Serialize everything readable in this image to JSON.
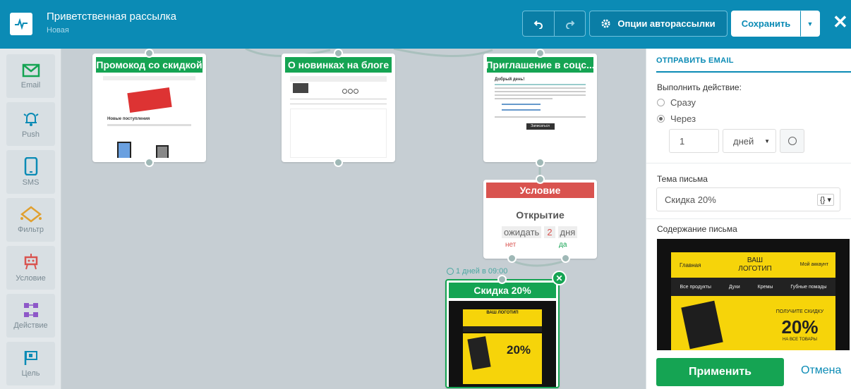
{
  "header": {
    "title": "Приветственная рассылка",
    "subtitle": "Новая",
    "options_label": "Опции авторассылки",
    "save_label": "Сохранить",
    "undo_icon": "undo-icon",
    "redo_icon": "redo-icon"
  },
  "toolbar": {
    "items": [
      {
        "label": "Email",
        "icon": "envelope-icon"
      },
      {
        "label": "Push",
        "icon": "bell-icon"
      },
      {
        "label": "SMS",
        "icon": "phone-icon"
      },
      {
        "label": "Фильтр",
        "icon": "filter-icon"
      },
      {
        "label": "Условие",
        "icon": "condition-icon"
      },
      {
        "label": "Действие",
        "icon": "action-icon"
      },
      {
        "label": "Цель",
        "icon": "flag-icon"
      }
    ]
  },
  "canvas": {
    "node1": {
      "title": "Промокод со скидкой",
      "pv_title": "Новые поступления"
    },
    "node2": {
      "title": "О новинках на блоге"
    },
    "node3": {
      "title": "Приглашение в соцс...",
      "pv_title": "Добрый день!",
      "pv_button": "Записаться"
    },
    "condition": {
      "title": "Условие",
      "event": "Открытие",
      "wait_label": "ожидать",
      "wait_value": "2",
      "wait_unit": "дня",
      "no_label": "нет",
      "yes_label": "да"
    },
    "timer": {
      "text": "1 дней в 09:00"
    },
    "node4": {
      "title": "Скидка 20%",
      "pv_logo": "ВАШ ЛОГОТИП",
      "pv_percent": "20%"
    }
  },
  "panel": {
    "heading": "ОТПРАВИТЬ EMAIL",
    "action_label": "Выполнить действие:",
    "option_now": "Сразу",
    "option_delay": "Через",
    "delay_value": "1",
    "delay_unit": "дней",
    "subject_label": "Тема письма",
    "subject_value": "Скидка 20%",
    "content_label": "Содержание письма",
    "preview": {
      "logo": "ВАШ ЛОГОТИП",
      "nav_left": "Главная",
      "nav_right": "Мой аккаунт",
      "menu": [
        "Все продукты",
        "Духи",
        "Кремы",
        "Губные помады"
      ],
      "promo_line1": "ПОЛУЧИТЕ СКИДКУ",
      "promo_percent": "20%",
      "promo_line2": "НА ВСЕ ТОВАРЫ"
    },
    "apply_label": "Применить",
    "cancel_label": "Отмена"
  },
  "colors": {
    "brand_blue": "#0b8bb5",
    "green": "#15a453",
    "red": "#d9534f",
    "promo_yellow": "#f6d40a"
  }
}
